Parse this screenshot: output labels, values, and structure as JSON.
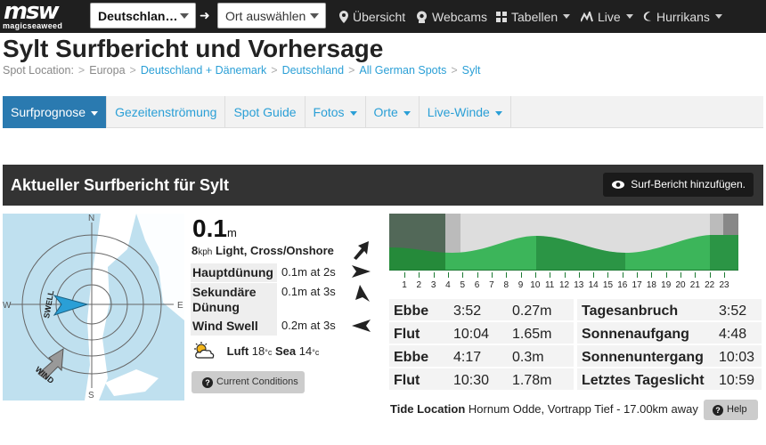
{
  "brand": {
    "logo": "msw",
    "name": "magicseaweed"
  },
  "topbar": {
    "country_select": "Deutschlan…",
    "spot_select": "Ort auswählen",
    "nav": [
      {
        "label": "Übersicht",
        "icon": "map-marker-icon"
      },
      {
        "label": "Webcams",
        "icon": "webcam-icon"
      },
      {
        "label": "Tabellen",
        "icon": "grid-icon"
      },
      {
        "label": "Live",
        "icon": "live-chart-icon"
      },
      {
        "label": "Hurrikans",
        "icon": "hurricane-icon"
      }
    ]
  },
  "page": {
    "title": "Sylt Surfbericht und Vorhersage"
  },
  "breadcrumb": {
    "prefix": "Spot Location:",
    "items": [
      "Europa",
      "Deutschland + Dänemark",
      "Deutschland",
      "All German Spots",
      "Sylt"
    ]
  },
  "tabs": [
    "Surfprognose",
    "Gezeitenströmung",
    "Spot Guide",
    "Fotos",
    "Orte",
    "Live-Winde"
  ],
  "report": {
    "heading": "Aktueller Surfbericht für Sylt",
    "add_button": "Surf-Bericht hinzufügen.",
    "compass": {
      "n": "N",
      "s": "S",
      "e": "E",
      "w": "W",
      "swell": "SWELL",
      "wind": "WIND"
    },
    "height": "0.1",
    "height_unit": "m",
    "wind_speed": "8",
    "wind_unit": "kph",
    "wind_desc": "Light, Cross/Onshore",
    "swells": [
      {
        "label": "Hauptdünung",
        "value": "0.1m at 2s"
      },
      {
        "label": "Sekundäre Dünung",
        "value": "0.1m at 3s"
      },
      {
        "label": "Wind Swell",
        "value": "0.2m at 3s"
      }
    ],
    "air_label": "Luft",
    "air_temp": "18",
    "sea_label": "Sea",
    "sea_temp": "14",
    "temp_unit": "°c",
    "current_conditions_button": "Current Conditions"
  },
  "tide": {
    "hours": [
      "1",
      "2",
      "3",
      "4",
      "5",
      "6",
      "7",
      "8",
      "9",
      "10",
      "11",
      "12",
      "13",
      "14",
      "15",
      "16",
      "17",
      "18",
      "19",
      "20",
      "21",
      "22",
      "23"
    ],
    "rows": [
      {
        "type": "Ebbe",
        "time": "3:52",
        "height": "0.27m",
        "sun_label": "Tagesanbruch",
        "sun_time": "3:52"
      },
      {
        "type": "Flut",
        "time": "10:04",
        "height": "1.65m",
        "sun_label": "Sonnenaufgang",
        "sun_time": "4:48"
      },
      {
        "type": "Ebbe",
        "time": "4:17",
        "height": "0.3m",
        "sun_label": "Sonnenuntergang",
        "sun_time": "10:03"
      },
      {
        "type": "Flut",
        "time": "10:30",
        "height": "1.78m",
        "sun_label": "Letztes Tageslicht",
        "sun_time": "10:59"
      }
    ],
    "location_label": "Tide Location",
    "location_value": "Hornum Odde, Vortrapp Tief - 17.00km away",
    "help_button": "Help"
  },
  "colors": {
    "accent": "#2a9fd6",
    "active_tab": "#2a7ab0",
    "sea": "#bfe0ef",
    "tide_green": "#3cb55a",
    "tide_dark": "#1e7a34"
  }
}
